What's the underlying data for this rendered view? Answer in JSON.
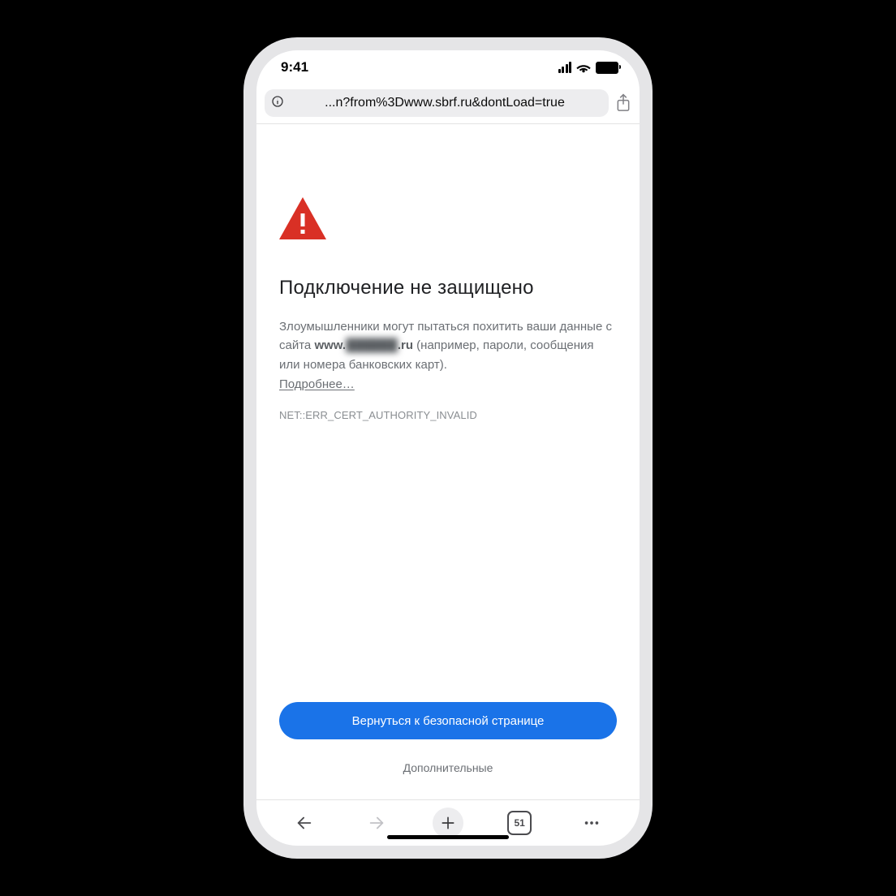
{
  "status": {
    "time": "9:41"
  },
  "url_bar": {
    "url_text": "...n?from%3Dwww.sbrf.ru&dontLoad=true"
  },
  "error_page": {
    "heading": "Подключение не защищено",
    "paragraph_pre": "Злоумышленники могут пытаться похитить ваши данные с сайта ",
    "site_prefix": "www.",
    "site_blurred": "██████",
    "site_suffix": ".ru",
    "paragraph_post": " (например, пароли, сообщения или номера банковских карт). ",
    "learn_more": "Подробнее…",
    "error_code": "NET::ERR_CERT_AUTHORITY_INVALID",
    "primary_button": "Вернуться к безопасной странице",
    "secondary_button": "Дополнительные"
  },
  "toolbar": {
    "tab_count": "51"
  },
  "colors": {
    "warning_red": "#d93025",
    "primary_blue": "#1a73e8"
  }
}
